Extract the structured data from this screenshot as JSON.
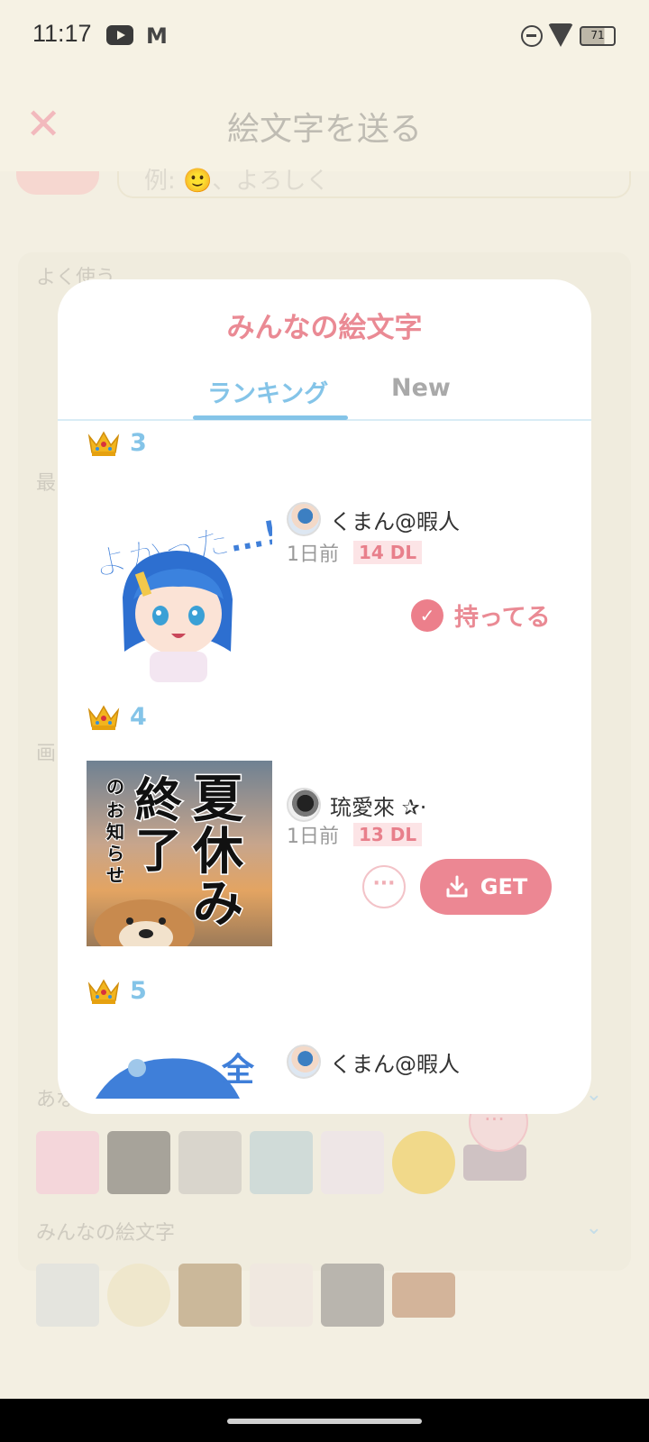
{
  "status_bar": {
    "time": "11:17",
    "battery": "71"
  },
  "header": {
    "title": "絵文字を送る",
    "close_icon": "close-icon"
  },
  "background": {
    "search_placeholder": "例: 🙂、よろしく",
    "section_frequent": "よく使う",
    "section_recent": "最",
    "section_image": "画",
    "section_recommend": "あなたにおすすめ",
    "section_everyone": "みんなの絵文字"
  },
  "modal": {
    "title": "みんなの絵文字",
    "tabs": [
      {
        "label": "ランキング",
        "selected": true
      },
      {
        "label": "New",
        "selected": false
      }
    ],
    "items": [
      {
        "rank": "3",
        "creator": "くまん@暇人",
        "time": "1日前",
        "downloads": "14 DL",
        "owned_label": "持ってる"
      },
      {
        "rank": "4",
        "creator": "琉愛來 ✰·",
        "time": "1日前",
        "downloads": "13 DL",
        "get_label": "GET",
        "sticker_text": "夏休み終了の、お知らせ"
      },
      {
        "rank": "5",
        "creator": "くまん@暇人"
      }
    ]
  },
  "colors": {
    "accent_pink": "#ec8793",
    "accent_blue": "#84c4e8",
    "background": "#f3efe2"
  }
}
